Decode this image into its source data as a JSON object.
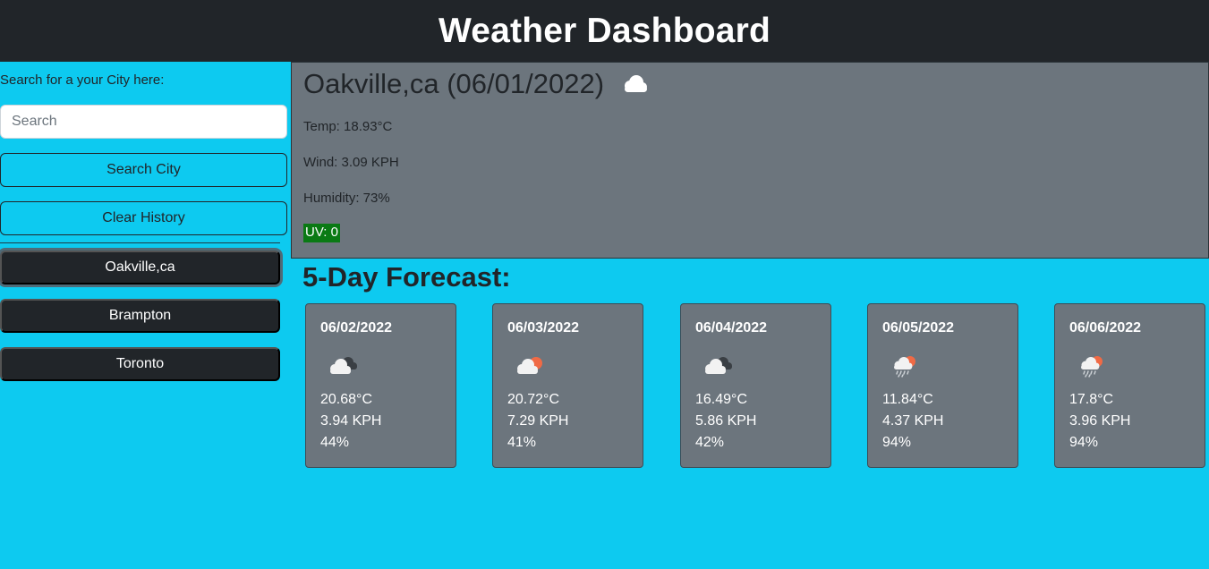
{
  "app": {
    "title": "Weather Dashboard"
  },
  "search": {
    "label": "Search for a your City here:",
    "placeholder": "Search",
    "value": "",
    "search_button": "Search City",
    "clear_button": "Clear History"
  },
  "history": [
    {
      "label": "Oakville,ca",
      "active": true
    },
    {
      "label": "Brampton",
      "active": false
    },
    {
      "label": "Toronto",
      "active": false
    }
  ],
  "current": {
    "title": "Oakville,ca (06/01/2022)",
    "icon": "cloud-icon",
    "temp": "Temp: 18.93°C",
    "wind": "Wind: 3.09 KPH",
    "humidity": "Humidity: 73%",
    "uv": "UV: 0",
    "uv_color": "#0a7a14"
  },
  "forecast": {
    "title": "5-Day Forecast:",
    "days": [
      {
        "date": "06/02/2022",
        "icon": "broken-clouds-icon",
        "temp": "20.68°C",
        "wind": "3.94 KPH",
        "humidity": "44%"
      },
      {
        "date": "06/03/2022",
        "icon": "sun-behind-cloud-icon",
        "temp": "20.72°C",
        "wind": "7.29 KPH",
        "humidity": "41%"
      },
      {
        "date": "06/04/2022",
        "icon": "broken-clouds-icon",
        "temp": "16.49°C",
        "wind": "5.86 KPH",
        "humidity": "42%"
      },
      {
        "date": "06/05/2022",
        "icon": "sun-rain-cloud-icon",
        "temp": "11.84°C",
        "wind": "4.37 KPH",
        "humidity": "94%"
      },
      {
        "date": "06/06/2022",
        "icon": "sun-rain-cloud-icon",
        "temp": "17.8°C",
        "wind": "3.96 KPH",
        "humidity": "94%"
      }
    ]
  },
  "colors": {
    "background": "#0dcaf0",
    "header": "#212529",
    "card": "#6c757d"
  }
}
